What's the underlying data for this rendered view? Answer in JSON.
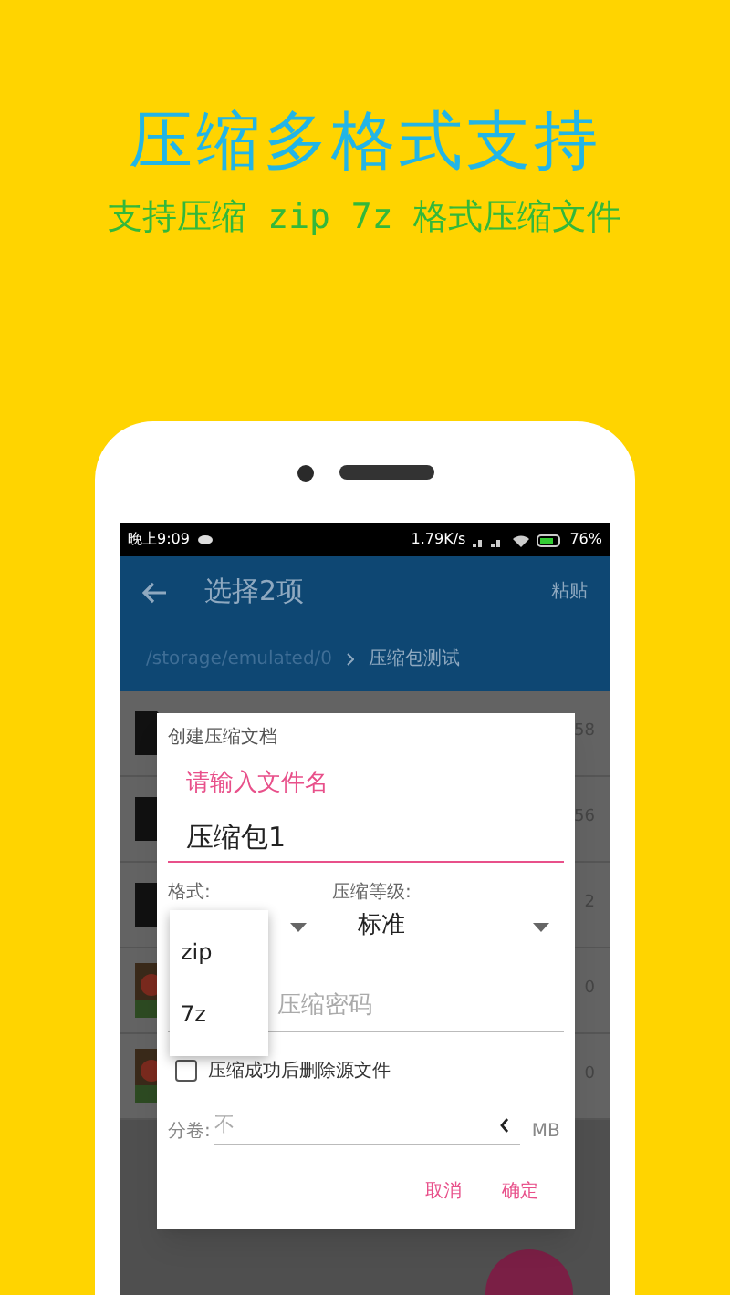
{
  "headline": "压缩多格式支持",
  "subheadline": "支持压缩 zip 7z 格式压缩文件",
  "status_bar": {
    "time": "晚上9:09",
    "speed": "1.79K/s",
    "battery": "76%"
  },
  "app_bar": {
    "title": "选择2项",
    "action": "粘贴"
  },
  "breadcrumb": [
    "/storage/emulated/0",
    "压缩包测试"
  ],
  "file_rows": [
    {
      "kind": "file",
      "size": "58"
    },
    {
      "kind": "file",
      "size": "56"
    },
    {
      "kind": "file",
      "size": "2"
    },
    {
      "kind": "image",
      "size": "0"
    },
    {
      "kind": "image",
      "size": "0"
    }
  ],
  "dialog": {
    "title": "创建压缩文档",
    "name_label": "请输入文件名",
    "name_value": "压缩包1",
    "format_label": "格式:",
    "level_label": "压缩等级:",
    "level_value": "标准",
    "password_placeholder": "压缩密码",
    "delete_source": {
      "label": "压缩成功后删除源文件",
      "checked": false
    },
    "split_label": "分卷:",
    "split_placeholder": "不",
    "split_unit": "MB",
    "buttons": [
      "取消",
      "确定"
    ]
  },
  "format_menu": [
    "zip",
    "7z"
  ]
}
